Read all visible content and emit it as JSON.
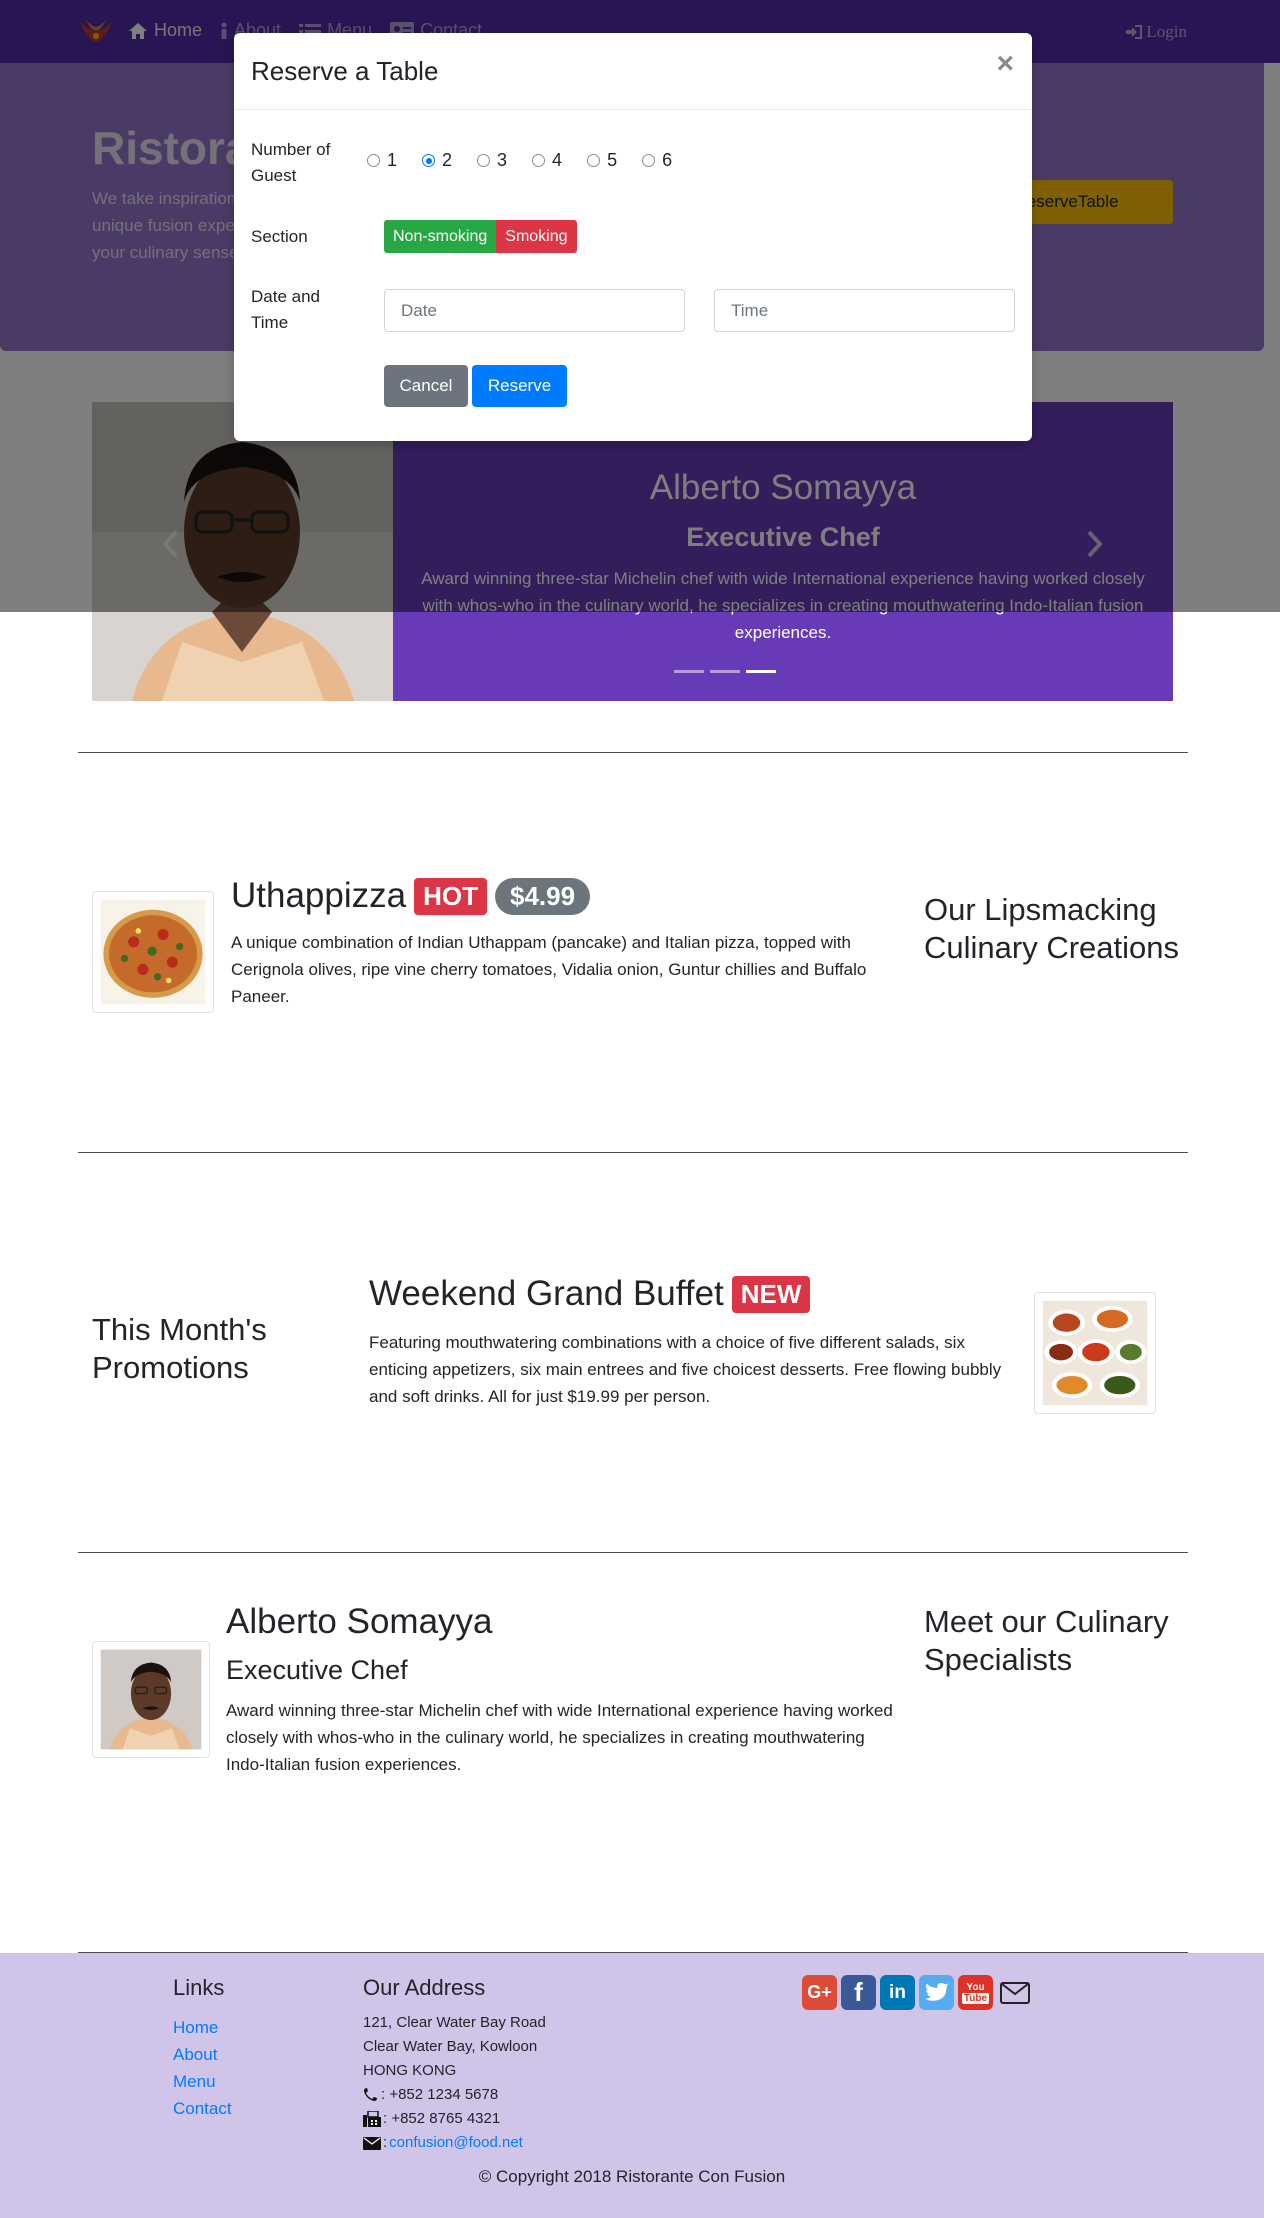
{
  "navbar": {
    "items": [
      "Home",
      "About",
      "Menu",
      "Contact"
    ],
    "login": "Login"
  },
  "jumbotron": {
    "title": "Ristorante Con Fusion",
    "text": "We take inspiration from the World's best cuisines, and create a unique fusion experience. Our lipsmacking creations will tickle your culinary senses!",
    "reserve_button": "ReserveTable"
  },
  "carousel": {
    "name": "Alberto Somayya",
    "role": "Executive Chef",
    "description": "Award winning three-star Michelin chef with wide International experience having worked closely with whos-who in the culinary world, he specializes in creating mouthwatering Indo-Italian fusion experiences.",
    "active_slide": 3,
    "slide_count": 3
  },
  "modal": {
    "title": "Reserve a Table",
    "close": "×",
    "guests_label": "Number of Guest",
    "guest_options": [
      "1",
      "2",
      "3",
      "4",
      "5",
      "6"
    ],
    "guest_selected": "2",
    "section_label": "Section",
    "section_nonsmoking": "Non-smoking",
    "section_smoking": "Smoking",
    "datetime_label": "Date and Time",
    "date_placeholder": "Date",
    "time_placeholder": "Time",
    "cancel": "Cancel",
    "reserve": "Reserve"
  },
  "dish": {
    "name": "Uthappizza",
    "badge_hot": "HOT",
    "price": "$4.99",
    "description": "A unique combination of Indian Uthappam (pancake) and Italian pizza, topped with Cerignola olives, ripe vine cherry tomatoes, Vidalia onion, Guntur chillies and Buffalo Paneer.",
    "side_heading": "Our Lipsmacking Culinary Creations"
  },
  "promotion": {
    "side_heading": "This Month's Promotions",
    "name": "Weekend Grand Buffet",
    "badge_new": "NEW",
    "description": "Featuring mouthwatering combinations with a choice of five different salads, six enticing appetizers, six main entrees and five choicest desserts. Free flowing bubbly and soft drinks. All for just $19.99 per person."
  },
  "leader": {
    "name": "Alberto Somayya",
    "role": "Executive Chef",
    "description": "Award winning three-star Michelin chef with wide International experience having worked closely with whos-who in the culinary world, he specializes in creating mouthwatering Indo-Italian fusion experiences.",
    "side_heading": "Meet our Culinary Specialists"
  },
  "footer": {
    "links_heading": "Links",
    "links": [
      "Home",
      "About",
      "Menu",
      "Contact"
    ],
    "address_heading": "Our Address",
    "address_lines": [
      "121, Clear Water Bay Road",
      "Clear Water Bay, Kowloon",
      "HONG KONG"
    ],
    "phone": ": +852 1234 5678",
    "fax": ": +852 8765 4321",
    "email_sep": ": ",
    "email": "confusion@food.net",
    "social_icons": [
      "google-plus-icon",
      "facebook-icon",
      "linkedin-icon",
      "twitter-icon",
      "youtube-icon",
      "envelope-icon"
    ],
    "youtube_text_top": "You",
    "youtube_text_bottom": "Tube",
    "copyright": "© Copyright 2018 Ristorante Con Fusion"
  },
  "colors": {
    "navbar": "#512da8",
    "jumbotron": "#9575cd",
    "footer": "#d1c4e9",
    "accent_warning": "#ffc107",
    "success": "#28a745",
    "danger": "#dc3545",
    "primary": "#007bff"
  }
}
